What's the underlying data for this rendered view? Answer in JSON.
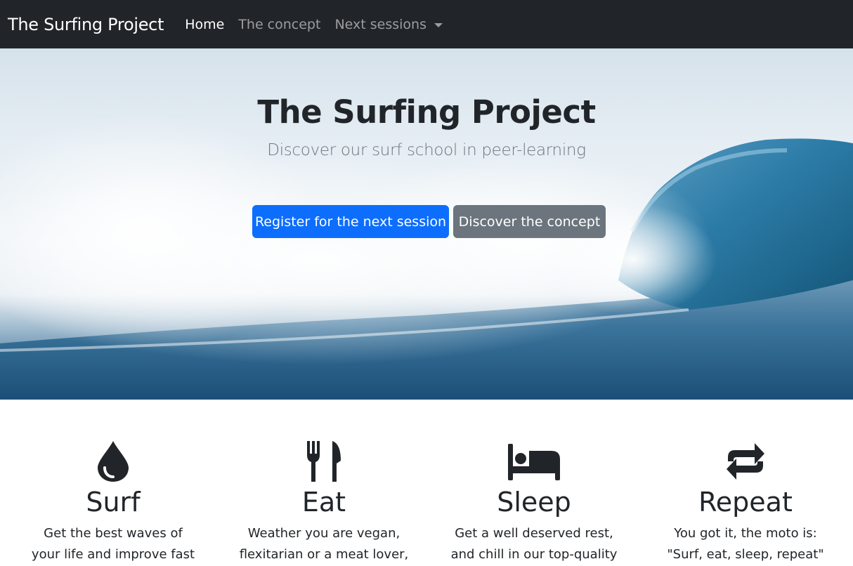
{
  "navbar": {
    "brand": "The Surfing Project",
    "links": [
      {
        "label": "Home",
        "active": true
      },
      {
        "label": "The concept",
        "active": false
      },
      {
        "label": "Next sessions",
        "active": false,
        "dropdown": true
      }
    ]
  },
  "hero": {
    "title": "The Surfing Project",
    "subtitle": "Discover our surf school in peer-learning",
    "primary_button": "Register for the next session",
    "secondary_button": "Discover the concept"
  },
  "features": [
    {
      "icon": "droplet-icon",
      "title": "Surf",
      "text_lines": [
        "Get the best waves of",
        "your life and improve fast"
      ]
    },
    {
      "icon": "fork-knife-icon",
      "title": "Eat",
      "text_lines": [
        "Weather you are vegan,",
        "flexitarian or a meat lover,"
      ]
    },
    {
      "icon": "bed-icon",
      "title": "Sleep",
      "text_lines": [
        "Get a well deserved rest,",
        "and chill in our top-quality"
      ]
    },
    {
      "icon": "repeat-icon",
      "title": "Repeat",
      "text_lines": [
        "You got it, the moto is:",
        "\"Surf, eat, sleep, repeat\""
      ]
    }
  ],
  "colors": {
    "navbar_bg": "#212529",
    "primary": "#0d6efd",
    "secondary": "#6c757d",
    "text": "#212529"
  }
}
